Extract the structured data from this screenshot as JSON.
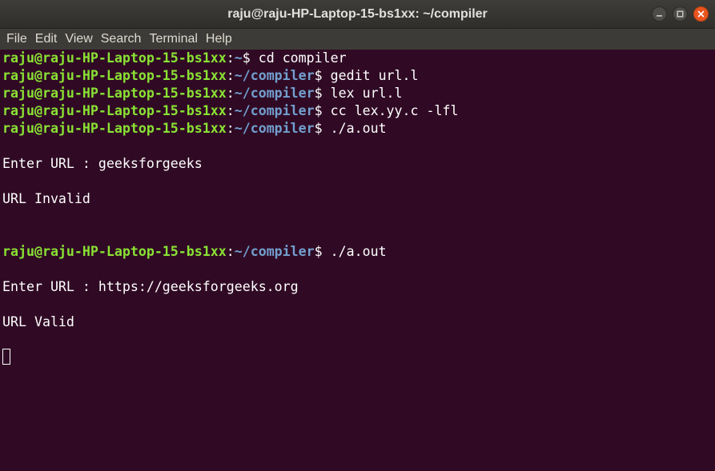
{
  "window": {
    "title": "raju@raju-HP-Laptop-15-bs1xx: ~/compiler"
  },
  "menu": {
    "items": [
      "File",
      "Edit",
      "View",
      "Search",
      "Terminal",
      "Help"
    ]
  },
  "colors": {
    "background": "#300a24",
    "prompt_user": "#8ae234",
    "prompt_path": "#729fcf",
    "text": "#ffffff",
    "close_button": "#e95420"
  },
  "terminal": {
    "lines": [
      {
        "type": "prompt",
        "user": "raju@raju-HP-Laptop-15-bs1xx",
        "sep": ":",
        "path": "~",
        "symbol": "$ ",
        "command": "cd compiler"
      },
      {
        "type": "prompt",
        "user": "raju@raju-HP-Laptop-15-bs1xx",
        "sep": ":",
        "path": "~/compiler",
        "symbol": "$ ",
        "command": "gedit url.l"
      },
      {
        "type": "prompt",
        "user": "raju@raju-HP-Laptop-15-bs1xx",
        "sep": ":",
        "path": "~/compiler",
        "symbol": "$ ",
        "command": "lex url.l"
      },
      {
        "type": "prompt",
        "user": "raju@raju-HP-Laptop-15-bs1xx",
        "sep": ":",
        "path": "~/compiler",
        "symbol": "$ ",
        "command": "cc lex.yy.c -lfl"
      },
      {
        "type": "prompt",
        "user": "raju@raju-HP-Laptop-15-bs1xx",
        "sep": ":",
        "path": "~/compiler",
        "symbol": "$ ",
        "command": "./a.out"
      },
      {
        "type": "output",
        "text": ""
      },
      {
        "type": "output",
        "text": "Enter URL : geeksforgeeks"
      },
      {
        "type": "output",
        "text": ""
      },
      {
        "type": "output",
        "text": "URL Invalid"
      },
      {
        "type": "output",
        "text": ""
      },
      {
        "type": "output",
        "text": ""
      },
      {
        "type": "prompt",
        "user": "raju@raju-HP-Laptop-15-bs1xx",
        "sep": ":",
        "path": "~/compiler",
        "symbol": "$ ",
        "command": "./a.out"
      },
      {
        "type": "output",
        "text": ""
      },
      {
        "type": "output",
        "text": "Enter URL : https://geeksforgeeks.org"
      },
      {
        "type": "output",
        "text": ""
      },
      {
        "type": "output",
        "text": "URL Valid"
      },
      {
        "type": "output",
        "text": ""
      },
      {
        "type": "cursor",
        "text": ""
      }
    ]
  }
}
